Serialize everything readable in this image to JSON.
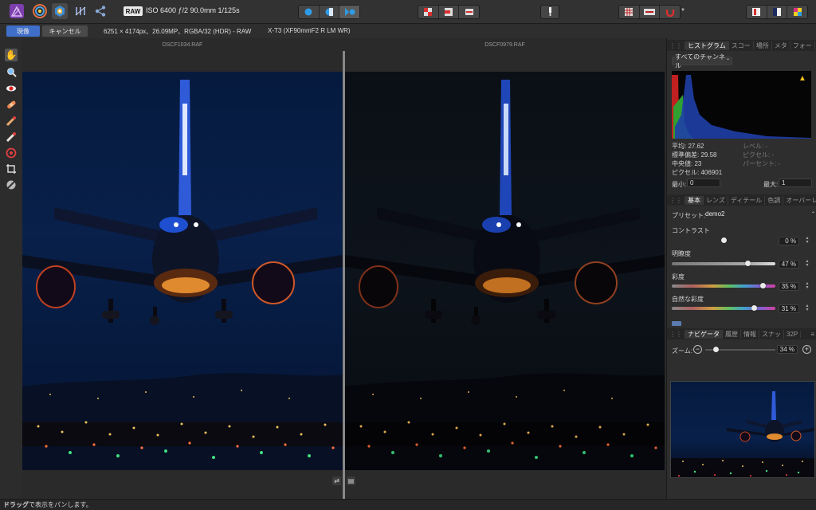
{
  "toolbar": {
    "raw_badge": "RAW",
    "exif": "ISO 6400 ƒ/2 90.0mm 1/125s"
  },
  "context": {
    "develop_button": "現像",
    "cancel_button": "キャンセル",
    "image_info": "6251 × 4174px、26.09MP、RGBA/32 (HDR) - RAW",
    "camera_info": "X-T3 (XF90mmF2 R LM WR)"
  },
  "split_view": {
    "left_file": "DSCF1034.RAF",
    "right_file": "DSCF0979.RAF"
  },
  "histogram": {
    "tabs": [
      "ヒストグラム",
      "スコー",
      "場所",
      "メタ",
      "フォー"
    ],
    "channel": "すべてのチャンネル",
    "stats": [
      {
        "label": "平均:",
        "value": "27.62"
      },
      {
        "label": "標準偏差:",
        "value": "29.58"
      },
      {
        "label": "中央値:",
        "value": "23"
      },
      {
        "label": "ピクセル:",
        "value": "406901"
      }
    ],
    "stats_right": [
      {
        "label": "レベル:",
        "value": "-"
      },
      {
        "label": "ピクセル:",
        "value": "-"
      },
      {
        "label": "パーセント:",
        "value": "-"
      }
    ],
    "min_label": "最小:",
    "min_value": "0",
    "max_label": "最大:",
    "max_value": "1"
  },
  "basic": {
    "tabs": [
      "基本",
      "レンズ",
      "ディテール",
      "色調",
      "オーバーレイ"
    ],
    "preset_label": "プリセット:",
    "preset_value": "demo2",
    "sliders": [
      {
        "label": "コントラスト",
        "value": "0 %",
        "level": 0.5
      },
      {
        "label": "明瞭度",
        "value": "47 %",
        "level": 0.73
      },
      {
        "label": "彩度",
        "value": "35 %",
        "level": 0.88
      },
      {
        "label": "自然な彩度",
        "value": "31 %",
        "level": 0.79
      }
    ]
  },
  "navigator": {
    "tabs": [
      "ナビゲータ",
      "履歴",
      "情報",
      "スナッ",
      "32P"
    ],
    "zoom_label": "ズーム:",
    "zoom_value": "34 %",
    "zoom_level": 0.15
  },
  "status": {
    "bold": "ドラッグ",
    "text": "で表示をパンします。"
  },
  "colors": {
    "accent": "#3f6fc9",
    "panel": "#2e2e2e",
    "toolbar": "#323232"
  }
}
